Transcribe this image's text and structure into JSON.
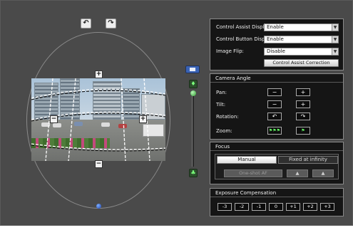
{
  "camera_view": {
    "rotate_left_icon": "↶",
    "rotate_right_icon": "↷",
    "zoom_handle_plus": "+",
    "zoom_handle_minus": "−",
    "handle_top": "+",
    "handle_left": "−",
    "handle_right": "+",
    "handle_bottom": "−"
  },
  "zoom_slider": {
    "level": 0.0,
    "top_icon": "person-icon",
    "bottom_icon": "group-icon"
  },
  "settings": {
    "control_assist_display": {
      "label": "Control Assist Display:",
      "value": "Enable"
    },
    "control_button_display": {
      "label": "Control Button Display:",
      "value": "Enable"
    },
    "image_flip": {
      "label": "Image Flip:",
      "value": "Disable"
    },
    "correction_button": "Control Assist Correction"
  },
  "camera_angle": {
    "title": "Camera Angle",
    "pan_label": "Pan:",
    "tilt_label": "Tilt:",
    "rotation_label": "Rotation:",
    "zoom_label": "Zoom:",
    "minus": "−",
    "plus": "+",
    "rotate_left": "↶",
    "rotate_right": "↷",
    "zoom_wide": "⚑⚑⚑",
    "zoom_tele": "⚑"
  },
  "focus": {
    "title": "Focus",
    "tab_manual": "Manual",
    "tab_fixed": "Fixed at infinity",
    "one_shot": "One-shot AF",
    "near": "▲",
    "far": "▲"
  },
  "exposure": {
    "title": "Exposure Compensation",
    "values": [
      "-3",
      "-2",
      "-1",
      "0",
      "+1",
      "+2",
      "+3"
    ]
  },
  "colors": {
    "panel_bg": "#151515",
    "main_bg": "#4a4a4a",
    "accent_blue": "#3a63b5",
    "accent_green": "#2f9a2f"
  }
}
